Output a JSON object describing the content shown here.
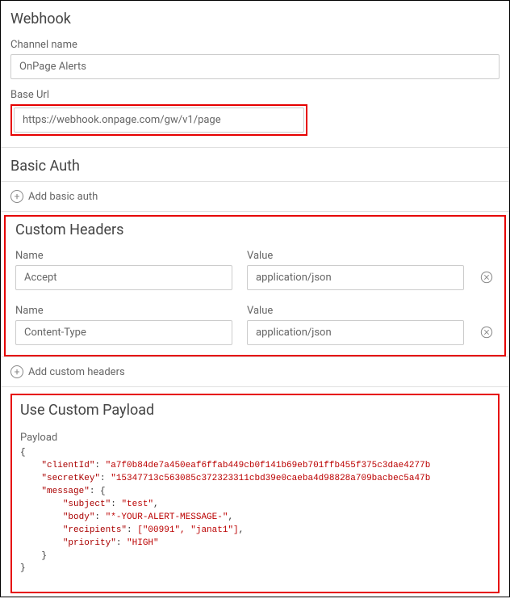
{
  "webhook": {
    "title": "Webhook",
    "channel_name_label": "Channel name",
    "channel_name_value": "OnPage Alerts",
    "base_url_label": "Base Url",
    "base_url_value": "https://webhook.onpage.com/gw/v1/page"
  },
  "basic_auth": {
    "title": "Basic Auth",
    "add_label": "Add basic auth"
  },
  "custom_headers": {
    "title": "Custom Headers",
    "name_label": "Name",
    "value_label": "Value",
    "rows": [
      {
        "name": "Accept",
        "value": "application/json"
      },
      {
        "name": "Content-Type",
        "value": "application/json"
      }
    ],
    "add_label": "Add custom headers"
  },
  "custom_payload": {
    "title": "Use Custom Payload",
    "payload_label": "Payload",
    "json": {
      "clientId": "a7f0b84de7a450eaf6ffab449cb0f141b69eb701ffb455f375c3dae4277b",
      "secretKey": "15347713c563085c372323311cbd39e0caeba4d98828a709bacbec5a47b",
      "message": {
        "subject": "test",
        "body": "*-YOUR-ALERT-MESSAGE-",
        "recipients": [
          "00991",
          "janat1"
        ],
        "priority": "HIGH"
      }
    },
    "lines": {
      "l1": "{",
      "l2_key": "\"clientId\"",
      "l2_val": "\"a7f0b84de7a450eaf6ffab449cb0f141b69eb701ffb455f375c3dae4277b",
      "l3_key": "\"secretKey\"",
      "l3_val": "\"15347713c563085c372323311cbd39e0caeba4d98828a709bacbec5a47b",
      "l4_key": "\"message\"",
      "l5_key": "\"subject\"",
      "l5_val": "\"test\"",
      "l6_key": "\"body\"",
      "l6_val": "\"*-YOUR-ALERT-MESSAGE-\"",
      "l7_key": "\"recipients\"",
      "l7_val": "[\"00991\", \"janat1\"]",
      "l8_key": "\"priority\"",
      "l8_val": "\"HIGH\"",
      "l9": "}",
      "l10": "}"
    }
  }
}
